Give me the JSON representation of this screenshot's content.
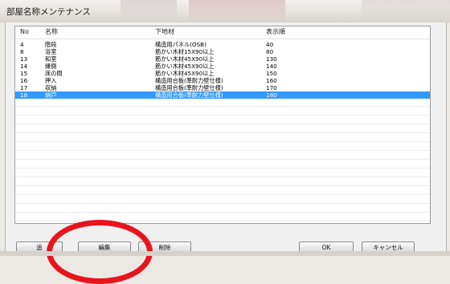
{
  "window": {
    "title": "部屋名称メンテナンス"
  },
  "list": {
    "columns": [
      "No",
      "名称",
      "下地材",
      "表示順"
    ],
    "rows": [
      {
        "no": "4",
        "name": "階段",
        "base": "構造用パネル(OSB)",
        "order": "40"
      },
      {
        "no": "8",
        "name": "浴室",
        "base": "筋かい木材15X90以上",
        "order": "80"
      },
      {
        "no": "13",
        "name": "和室",
        "base": "筋かい木材45X90以上",
        "order": "130"
      },
      {
        "no": "14",
        "name": "縁側",
        "base": "筋かい木材45X90以上",
        "order": "140"
      },
      {
        "no": "15",
        "name": "床の間",
        "base": "筋かい木材45X90以上",
        "order": "150"
      },
      {
        "no": "16",
        "name": "押入",
        "base": "構造用合板(準耐力壁仕様)",
        "order": "160"
      },
      {
        "no": "17",
        "name": "収納",
        "base": "構造用合板(準耐力壁仕様)",
        "order": "170"
      },
      {
        "no": "18",
        "name": "納戸",
        "base": "構造用合板(準耐力壁仕様)",
        "order": "180"
      }
    ],
    "selected_index": 7
  },
  "buttons": {
    "add": "追",
    "edit": "編集",
    "delete": "削除",
    "ok": "OK",
    "cancel": "キャンセル"
  },
  "colors": {
    "selection": "#3399ff",
    "annotation": "#e8141c"
  }
}
